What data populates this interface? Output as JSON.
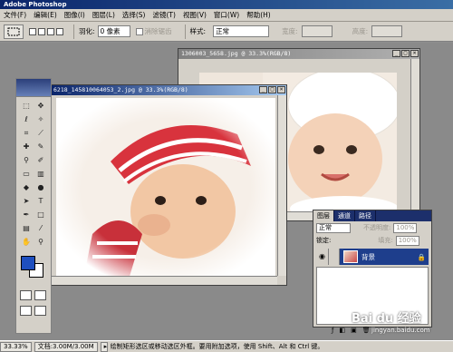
{
  "app": {
    "title": "Adobe Photoshop"
  },
  "menu": [
    "文件(F)",
    "编辑(E)",
    "图像(I)",
    "图层(L)",
    "选择(S)",
    "滤镜(T)",
    "视图(V)",
    "窗口(W)",
    "帮助(H)"
  ],
  "options": {
    "feather_label": "羽化:",
    "feather_value": "0 像素",
    "antialias_label": "消除锯齿",
    "style_label": "样式:",
    "style_value": "正常",
    "width_label": "宽度:",
    "height_label": "高度:"
  },
  "documents": {
    "back": {
      "title": "1306003_5658.jpg @ 33.3%(RGB/8)"
    },
    "front": {
      "title": "6218_145810064053_2.jpg @ 33.3%(RGB/8)"
    }
  },
  "layers_panel": {
    "tabs": [
      "图层",
      "通道",
      "路径"
    ],
    "blend_mode": "正常",
    "opacity_label": "不透明度:",
    "opacity_value": "100%",
    "lock_label": "锁定:",
    "fill_label": "填充:",
    "fill_value": "100%",
    "layer_name": "背景",
    "eye_icon": "eye-icon",
    "lock_icon": "lock-icon"
  },
  "status": {
    "zoom": "33.33%",
    "doc_info": "文档:3.00M/3.00M",
    "message": "绘制矩形选区或移动选区外框。要用附加选项，使用 Shift、Alt 和 Ctrl 键。"
  },
  "watermark": {
    "main": "Bai du 经验",
    "sub": "jingyan.baidu.com"
  }
}
